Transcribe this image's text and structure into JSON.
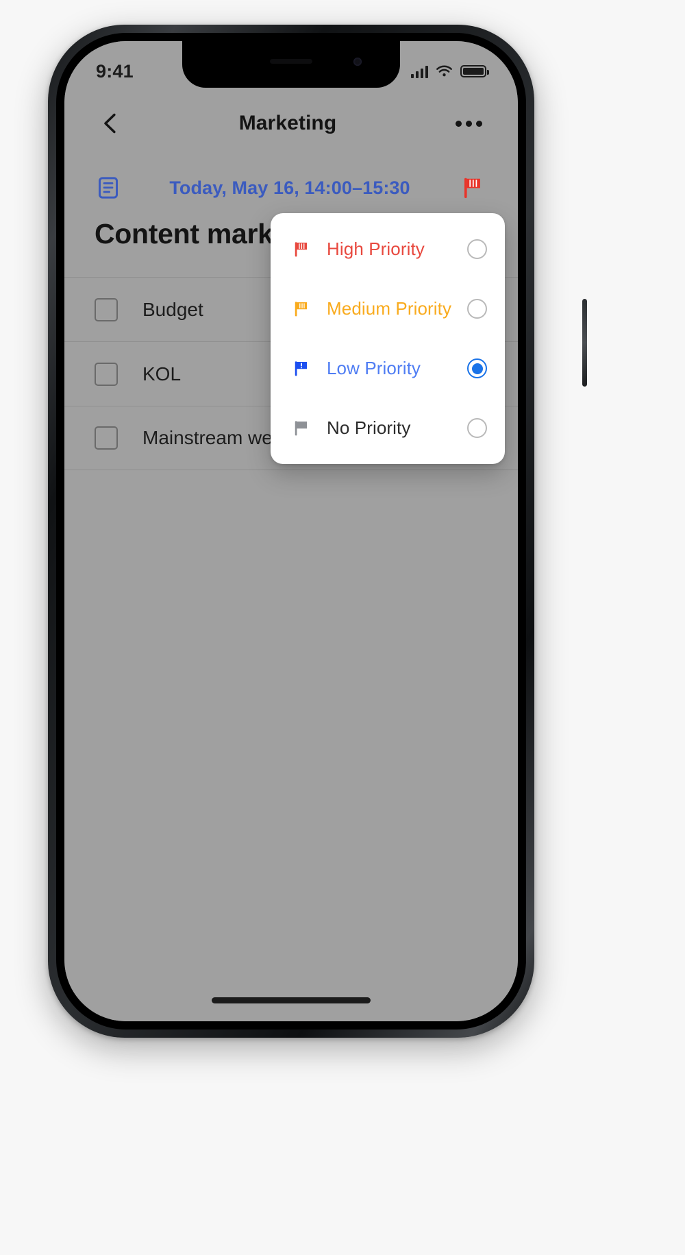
{
  "status_bar": {
    "time": "9:41",
    "signal_icon": "cellular-signal-icon",
    "wifi_icon": "wifi-icon",
    "battery_icon": "battery-full-icon"
  },
  "nav": {
    "back_icon": "chevron-left-icon",
    "title": "Marketing",
    "more_icon": "more-options-icon"
  },
  "detail": {
    "doc_icon": "note-lines-icon",
    "date_text": "Today, May 16, 14:00–15:30",
    "date_color": "#3b5bbf",
    "flag_icon": "flag-icon",
    "flag_color": "#e8342a",
    "task_title": "Content marketing"
  },
  "subtasks": [
    {
      "label": "Budget",
      "checked": false,
      "checkbox_icon": "checkbox-unchecked-icon"
    },
    {
      "label": "KOL",
      "checked": false,
      "checkbox_icon": "checkbox-unchecked-icon"
    },
    {
      "label": "Mainstream website",
      "checked": false,
      "checkbox_icon": "checkbox-unchecked-icon"
    }
  ],
  "priority_popup": {
    "options": [
      {
        "label": "High Priority",
        "color": "#e8493f",
        "flag_icon": "flag-high-icon",
        "selected": false,
        "radio_icon": "radio-unselected-icon"
      },
      {
        "label": "Medium Priority",
        "color": "#f9ab1e",
        "flag_icon": "flag-medium-icon",
        "selected": false,
        "radio_icon": "radio-unselected-icon"
      },
      {
        "label": "Low Priority",
        "color": "#4f7df3",
        "flag_icon": "flag-low-icon",
        "selected": true,
        "radio_icon": "radio-selected-icon"
      },
      {
        "label": "No Priority",
        "color": "#2b2b2b",
        "flag_icon": "flag-none-icon",
        "selected": false,
        "radio_icon": "radio-unselected-icon"
      }
    ],
    "selected_value": "Low Priority",
    "accent_color": "#1a73e8"
  },
  "home_indicator": "home-indicator"
}
